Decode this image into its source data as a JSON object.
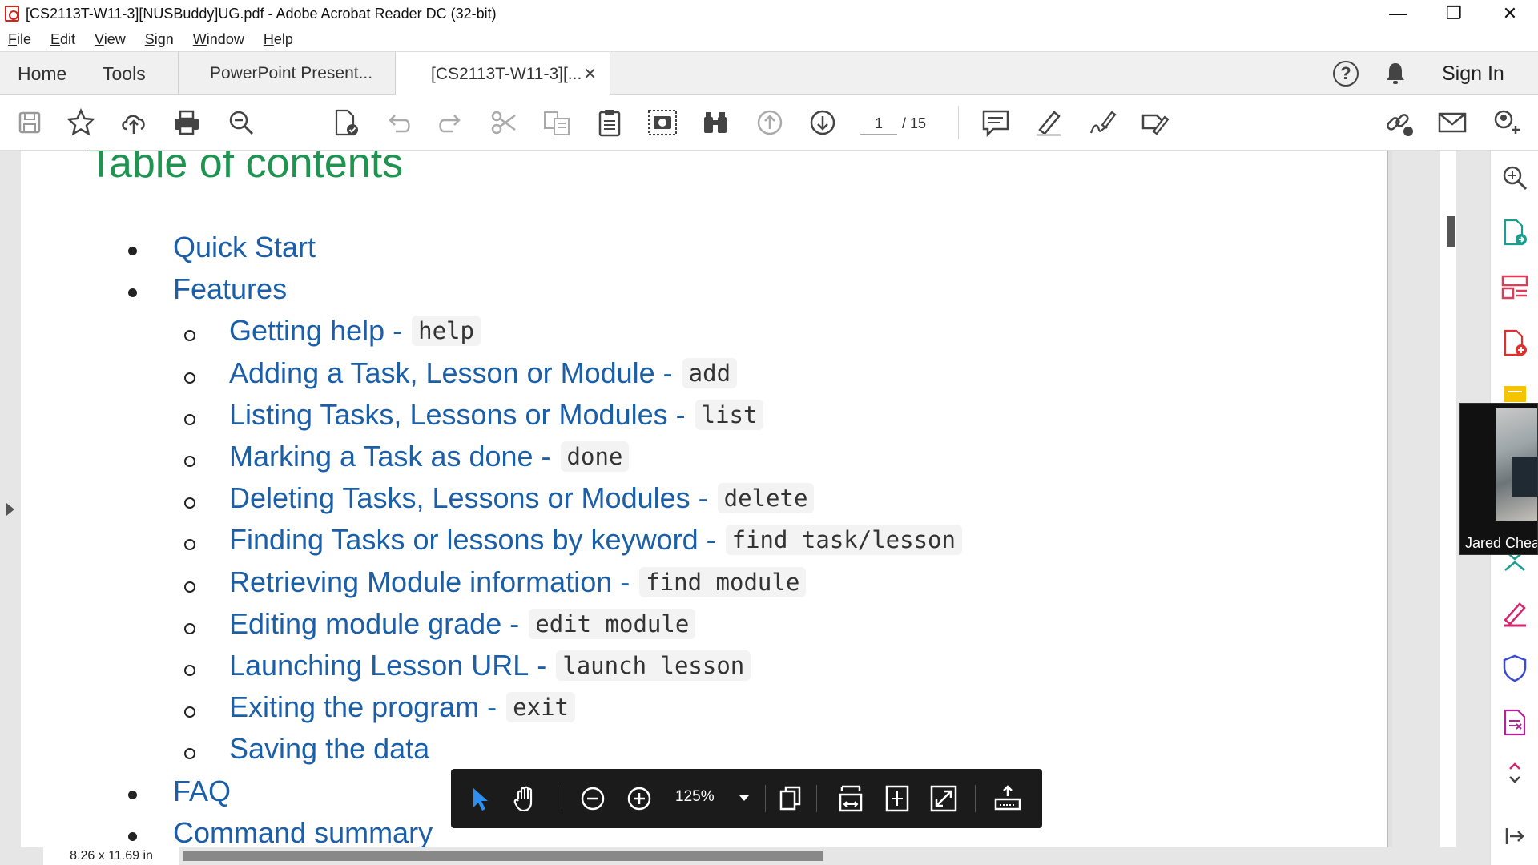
{
  "window": {
    "title": "[CS2113T-W11-3][NUSBuddy]UG.pdf - Adobe Acrobat Reader DC (32-bit)",
    "minimize": "—",
    "maximize": "❐",
    "close": "✕"
  },
  "menu": [
    "File",
    "Edit",
    "View",
    "Sign",
    "Window",
    "Help"
  ],
  "tabs": {
    "home": "Home",
    "tools": "Tools",
    "doc1": "PowerPoint Present...",
    "doc2": "[CS2113T-W11-3][...",
    "close_glyph": "✕",
    "help": "?",
    "sign_in": "Sign In"
  },
  "toolbar": {
    "page_current": "1",
    "page_total": "/ 15",
    "icons": [
      "save-icon",
      "bookmark-star-icon",
      "upload-cloud-icon",
      "print-icon",
      "find-zoom-icon",
      "edit-pdf-icon",
      "undo-icon",
      "redo-icon",
      "cut-icon",
      "copy-format-icon",
      "clipboard-icon",
      "snapshot-icon",
      "binoculars-icon",
      "previous-page-icon",
      "next-page-icon",
      "comment-icon",
      "highlight-icon",
      "sign-icon",
      "fill-sign-icon",
      "share-link-icon",
      "email-icon",
      "add-user-icon"
    ]
  },
  "document": {
    "heading": "Table of contents",
    "toc": [
      {
        "level": 1,
        "text": "Quick Start",
        "code": ""
      },
      {
        "level": 1,
        "text": "Features",
        "code": ""
      },
      {
        "level": 2,
        "text": "Getting help",
        "code": "help"
      },
      {
        "level": 2,
        "text": "Adding a Task, Lesson or Module",
        "code": "add"
      },
      {
        "level": 2,
        "text": "Listing Tasks, Lessons or Modules",
        "code": "list"
      },
      {
        "level": 2,
        "text": "Marking a Task as done",
        "code": "done"
      },
      {
        "level": 2,
        "text": "Deleting Tasks, Lessons or Modules",
        "code": "delete"
      },
      {
        "level": 2,
        "text": "Finding Tasks or lessons by keyword",
        "code": "find task/lesson"
      },
      {
        "level": 2,
        "text": "Retrieving Module information",
        "code": "find module"
      },
      {
        "level": 2,
        "text": "Editing module grade",
        "code": "edit module"
      },
      {
        "level": 2,
        "text": "Launching Lesson URL",
        "code": "launch lesson"
      },
      {
        "level": 2,
        "text": "Exiting the program",
        "code": "exit"
      },
      {
        "level": 2,
        "text": "Saving the data",
        "code": ""
      },
      {
        "level": 1,
        "text": "FAQ",
        "code": ""
      },
      {
        "level": 1,
        "text": "Command summary",
        "code": ""
      }
    ]
  },
  "status": {
    "page_size": "8.26 x 11.69 in"
  },
  "float_toolbar": {
    "zoom": "125%"
  },
  "video": {
    "participant": "Jared Chea"
  },
  "colors": {
    "heading": "#1f9451",
    "link": "#1a5fa8",
    "accent_red": "#d2231f"
  }
}
